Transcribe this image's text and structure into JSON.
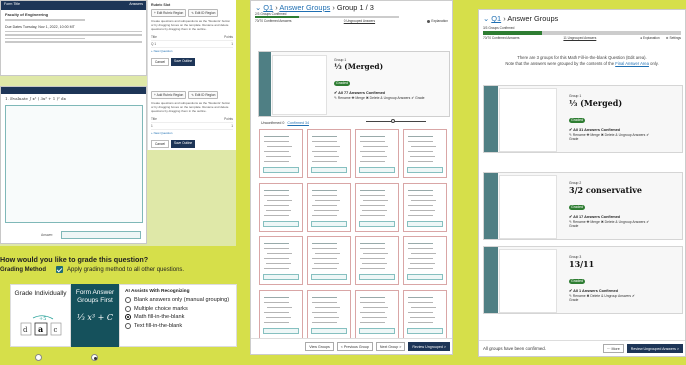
{
  "left": {
    "doc": {
      "header_left": "Form Title",
      "header_right": "Answers",
      "title": "Faculty of Engineering",
      "exam_label": "Due Dates",
      "date_line": "Due Dates    Tuesday, Nov 1, 2022, 10:00 MT"
    },
    "side_panel": {
      "title": "Rubric Slot",
      "btn_add": "+ Edit Rubric Region",
      "btn_edit": "✎ Edit ID Region",
      "description": "Create questions and subquestions as the 'Students' button or by dragging boxes on the template. Rename and delete questions by dragging them in the outline.",
      "col_title": "Title",
      "col_points": "Points",
      "row1_title": "Q 1",
      "row1_points": "1",
      "new_question": "+ New Question",
      "cancel": "Cancel",
      "save": "Save Outline"
    },
    "side_panel2": {
      "btn_add": "+ Add Rubric Region",
      "btn_edit": "✎ Edit ID Region",
      "description": "Create questions and subquestions as the 'Students' button or by dragging boxes on the template. Rename and delete questions by dragging them in the outline.",
      "col_title": "Title",
      "col_points": "Points",
      "row1_title": "1",
      "row1_points": "1",
      "new_question": "+ New Question",
      "cancel": "Cancel",
      "save": "Save Outline"
    },
    "work": {
      "equation": "1.  Evaluate  ∫ x² ( 3x³ + 1 )² dx",
      "answer_label": "Answer:"
    },
    "grade_question": "How would you like to grade this question?",
    "grading_method_label": "Grading Method",
    "apply_all_label": "Apply grading method to all other questions.",
    "card_individual": "Grade Individually",
    "card_form": "Form Answer Groups First",
    "card_form_eq": "¹⁄₃ x³ + C",
    "ai_title": "AI Assists With Recognizing",
    "ai_options": [
      "Blank answers only (manual grouping)",
      "Multiple choice marks",
      "Math fill-in-the-blank",
      "Text fill-in-the-blank"
    ],
    "ai_selected_index": 2
  },
  "middle": {
    "crumb_q": "Q1",
    "crumb_groups": "Answer Groups",
    "crumb_current": "Group 1 / 3",
    "groups_confirmed": "2/3 Groups Confirmed",
    "confirmed_answers": "70/70 Confirmed Answers",
    "ungrouped": "0 Ungrouped Answers",
    "explanation": "Explanation",
    "group": {
      "label": "Group 1",
      "fraction": "¹⁄₃ (Merged)",
      "badge": "Graded",
      "confirmed": "✔ All 77 Answers Confirmed",
      "ops": "✎ Rename  ✚ Merge  ✖ Delete & Ungroup Answers  ✔ Grade"
    },
    "tab_unconf": "Unconfirmed 0",
    "tab_conf": "Confirmed 34",
    "footer": {
      "view_groups": "View Groups",
      "previous": "< Previous Group",
      "next": "Next Group >",
      "review": "Review Ungrouped >"
    }
  },
  "right": {
    "crumb_q": "Q1",
    "crumb_current": "Answer Groups",
    "groups_confirmed": "3/3 Groups Confirmed",
    "confirmed_answers": "70/70 Confirmed Answers",
    "ungrouped": "11 Ungrouped Answers",
    "explanation": "Explanation",
    "settings": "Settings",
    "notice_1": "There are 3 groups for this Math Fill-in-the-blank Question (Edit area).",
    "notice_2": "Note that the answers were grouped by the contents of the",
    "notice_link": "Final Answer Area",
    "notice_end": "only.",
    "groups": [
      {
        "label": "Group 1",
        "fraction": "¹⁄₃ (Merged)",
        "badge": "Graded",
        "confirmed": "✔ All 31 Answers Confirmed",
        "ops": "✎ Rename  ✚ Merge  ✖ Delete & Ungroup Answers  ✔",
        "grade": "Grade"
      },
      {
        "label": "Group 2",
        "fraction": "3/2 conservative",
        "badge": "Graded",
        "confirmed": "✔ All 17 Answers Confirmed",
        "ops": "✎ Rename  ✚ Merge  ✖ Delete & Ungroup Answers  ✔",
        "grade": "Grade"
      },
      {
        "label": "Group 3",
        "fraction": "13/11",
        "badge": "Graded",
        "confirmed": "✔ All 1 Answers Confirmed",
        "ops": "✎ Rename  ✖ Delete & Ungroup Answers  ✔",
        "grade": "Grade"
      }
    ],
    "all_confirmed": "All groups have been confirmed.",
    "more": "⋯ More",
    "review": "Review Ungrouped Answers >"
  }
}
